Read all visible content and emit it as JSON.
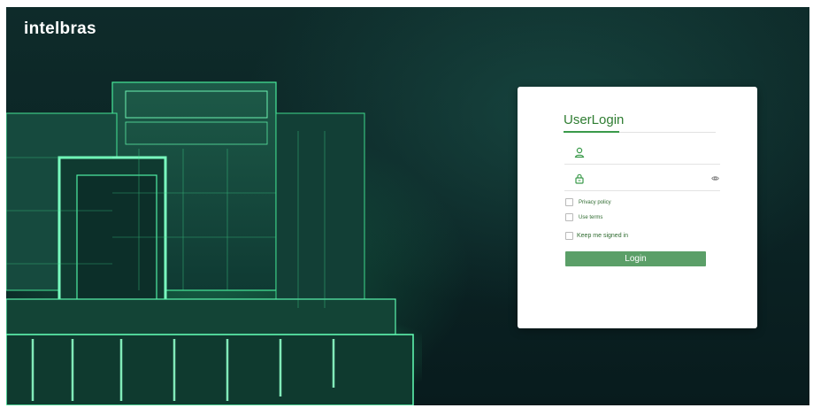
{
  "brand": {
    "logo_text": "intelbras"
  },
  "login": {
    "title": "UserLogin",
    "username_value": "",
    "password_value": "",
    "checkboxes": [
      {
        "label": "Privacy policy",
        "checked": false
      },
      {
        "label": "Use terms",
        "checked": false
      },
      {
        "label": "Keep me signed in",
        "checked": false
      }
    ],
    "button_label": "Login"
  },
  "icons": {
    "username": "user-icon",
    "password": "lock-icon",
    "show_password": "eye-icon"
  },
  "colors": {
    "accent": "#3a9a4a",
    "button": "#5b9f68",
    "background_dark": "#0b2324",
    "glow": "#2bd982"
  }
}
